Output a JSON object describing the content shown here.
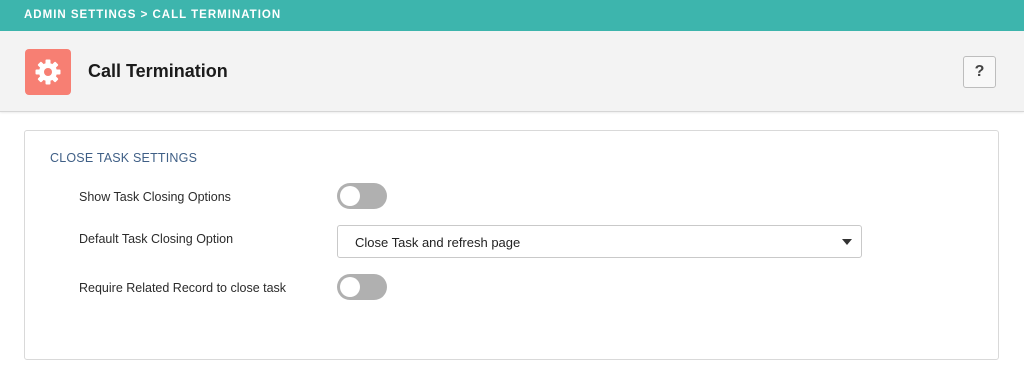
{
  "breadcrumb": "ADMIN SETTINGS > CALL TERMINATION",
  "header": {
    "icon": "gear-icon",
    "icon_color": "#f77f73",
    "title": "Call Termination",
    "help_label": "?"
  },
  "panel": {
    "section_title": "CLOSE TASK SETTINGS",
    "rows": [
      {
        "label": "Show Task Closing Options",
        "control": "toggle",
        "on": false
      },
      {
        "label": "Default Task Closing Option",
        "control": "select",
        "value": "Close Task and refresh page"
      },
      {
        "label": "Require Related Record to close task",
        "control": "toggle",
        "on": false
      }
    ]
  },
  "colors": {
    "topbar": "#3db5ad",
    "section_title": "#3f5f86",
    "toggle_off": "#b0b0b0"
  }
}
